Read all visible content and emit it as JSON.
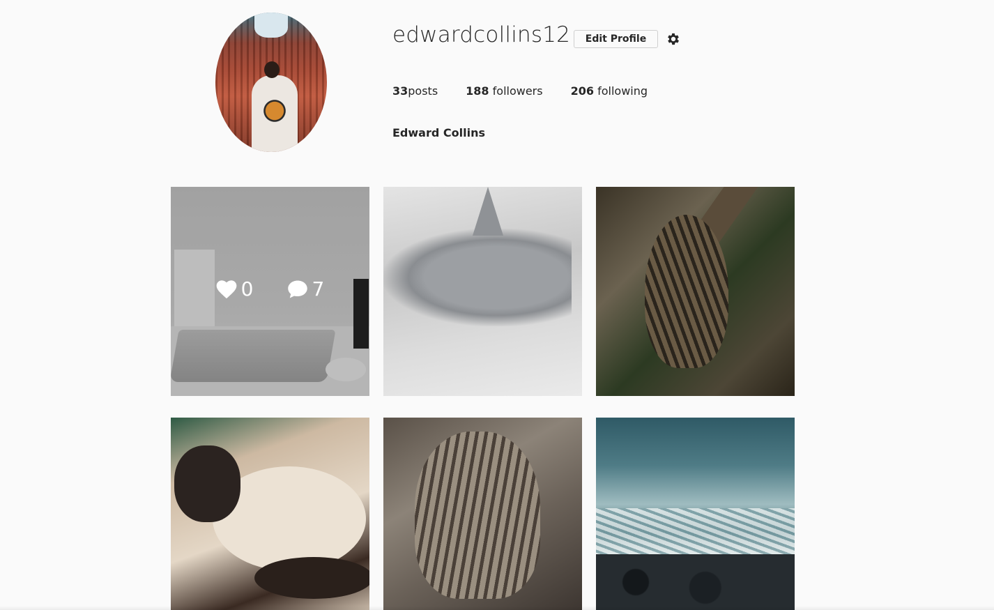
{
  "profile": {
    "username": "edwardcollins12",
    "edit_label": "Edit Profile",
    "full_name": "Edward Collins",
    "stats": {
      "posts_count": "33",
      "posts_label": "posts",
      "followers_count": "188",
      "followers_label": " followers",
      "following_count": "206",
      "following_label": " following"
    }
  },
  "icons": {
    "settings": "gear-icon",
    "like": "heart-icon",
    "comment": "comment-icon"
  },
  "posts": [
    {
      "likes": "0",
      "comments": "7",
      "hovered": true
    },
    {
      "hovered": false
    },
    {
      "hovered": false
    },
    {
      "hovered": false
    },
    {
      "hovered": false
    },
    {
      "hovered": false
    }
  ]
}
